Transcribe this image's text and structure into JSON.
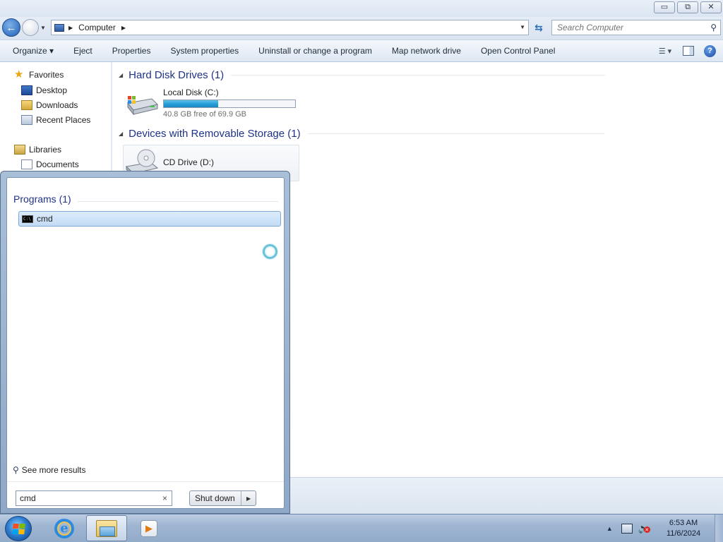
{
  "window": {
    "minimize_glyph": "▭",
    "restore_glyph": "⧉",
    "close_glyph": "✕"
  },
  "address": {
    "crumbs": [
      "Computer"
    ],
    "icon": "computer-icon"
  },
  "search": {
    "placeholder": "Search Computer"
  },
  "toolbar": {
    "organize": "Organize ▾",
    "eject": "Eject",
    "properties": "Properties",
    "system_properties": "System properties",
    "uninstall": "Uninstall or change a program",
    "map_drive": "Map network drive",
    "control_panel": "Open Control Panel",
    "help_glyph": "?"
  },
  "nav": {
    "favorites": "Favorites",
    "desktop": "Desktop",
    "downloads": "Downloads",
    "recent": "Recent Places",
    "libraries": "Libraries",
    "documents": "Documents"
  },
  "content": {
    "hdd_group": "Hard Disk Drives (1)",
    "removable_group": "Devices with Removable Storage (1)",
    "local_disk": {
      "name": "Local Disk (C:)",
      "free_text": "40.8 GB free of 69.9 GB",
      "used_fraction": 0.416
    },
    "cd_drive": {
      "name": "CD Drive (D:)"
    }
  },
  "start_menu": {
    "programs_header": "Programs (1)",
    "result": "cmd",
    "see_more": "See more results",
    "search_value": "cmd",
    "clear_glyph": "×",
    "shutdown": "Shut down"
  },
  "taskbar": {
    "pinned": [
      "internet-explorer",
      "windows-explorer",
      "windows-media-player"
    ],
    "time": "6:53 AM",
    "date": "11/6/2024"
  }
}
